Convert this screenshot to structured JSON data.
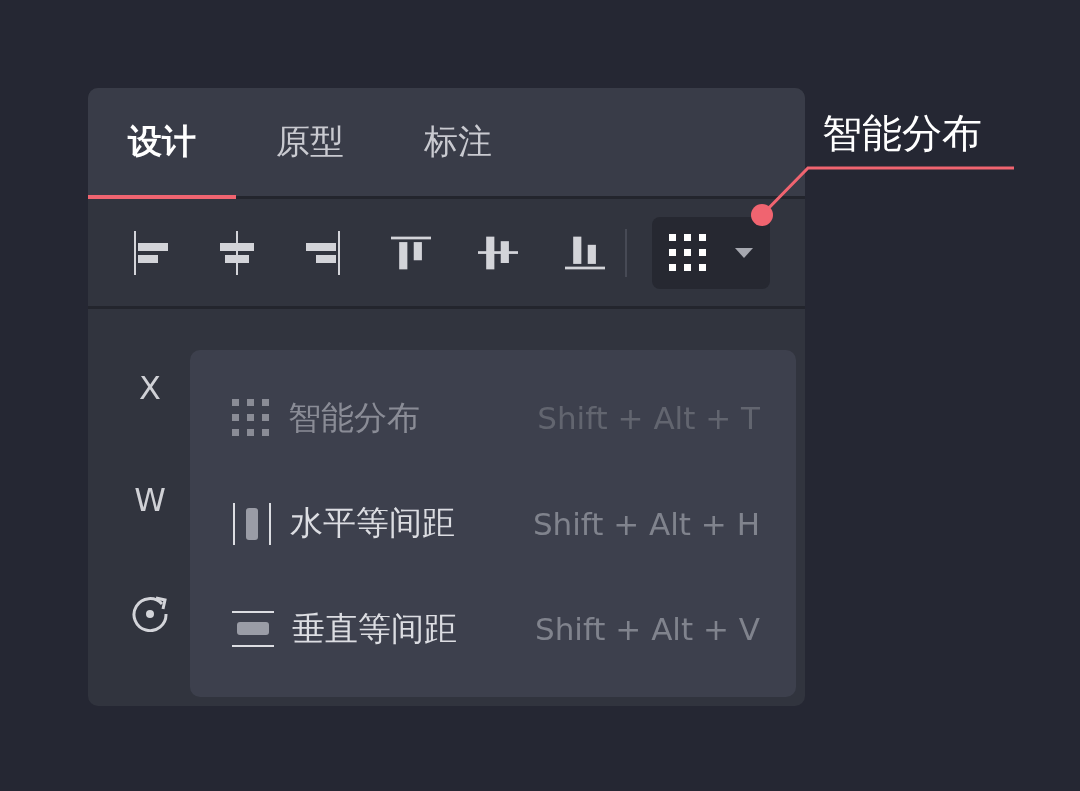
{
  "tabs": [
    {
      "label": "设计",
      "selected": true
    },
    {
      "label": "原型",
      "selected": false
    },
    {
      "label": "标注",
      "selected": false
    }
  ],
  "distribute_button": {
    "expanded": true
  },
  "properties": [
    {
      "label": "X",
      "kind": "text"
    },
    {
      "label": "W",
      "kind": "text"
    },
    {
      "kind": "rotation"
    }
  ],
  "menu": [
    {
      "kind": "smart",
      "label": "智能分布",
      "shortcut": "Shift + Alt + T",
      "disabled": true
    },
    {
      "kind": "horizontal",
      "label": "水平等间距",
      "shortcut": "Shift + Alt + H",
      "disabled": false
    },
    {
      "kind": "vertical",
      "label": "垂直等间距",
      "shortcut": "Shift + Alt + V",
      "disabled": false
    }
  ],
  "callout": {
    "label": "智能分布"
  }
}
